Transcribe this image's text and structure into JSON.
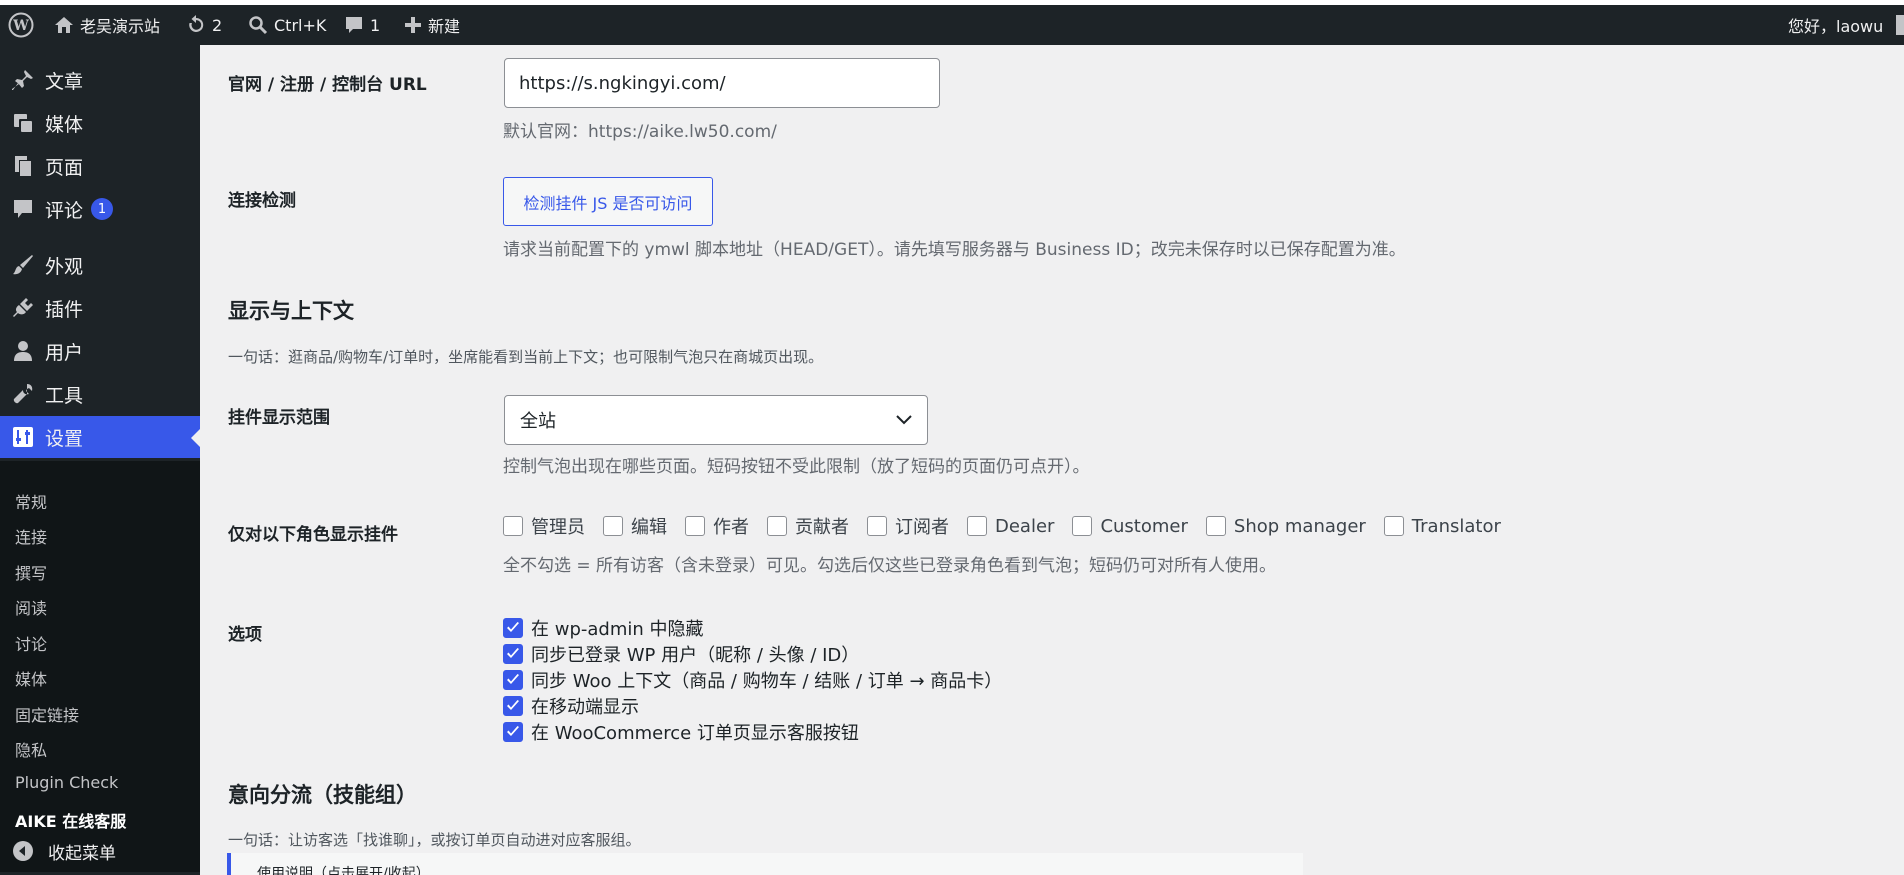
{
  "admin_bar": {
    "site_name": "老吴演示站",
    "updates_count": "2",
    "search_shortcut": "Ctrl+K",
    "comments_count": "1",
    "new_label": "新建",
    "greeting": "您好，laowu"
  },
  "sidebar": {
    "items": [
      {
        "label": "文章",
        "icon": "pin-icon"
      },
      {
        "label": "媒体",
        "icon": "media-icon"
      },
      {
        "label": "页面",
        "icon": "page-icon"
      },
      {
        "label": "评论",
        "icon": "comment-icon",
        "badge": "1"
      },
      {
        "label": "外观",
        "icon": "brush-icon"
      },
      {
        "label": "插件",
        "icon": "plugin-icon"
      },
      {
        "label": "用户",
        "icon": "user-icon"
      },
      {
        "label": "工具",
        "icon": "wrench-icon"
      },
      {
        "label": "设置",
        "icon": "settings-icon",
        "active": true
      }
    ],
    "submenu": [
      "常规",
      "连接",
      "撰写",
      "阅读",
      "讨论",
      "媒体",
      "固定链接",
      "隐私",
      "Plugin Check",
      "AIKE 在线客服"
    ],
    "collapse_label": "收起菜单"
  },
  "main": {
    "url_row": {
      "label": "官网 / 注册 / 控制台 URL",
      "value": "https://s.ngkingyi.com/",
      "desc": "默认官网：https://aike.lw50.com/"
    },
    "connection_row": {
      "label": "连接检测",
      "button": "检测挂件 JS 是否可访问",
      "desc": "请求当前配置下的 ymwl 脚本地址（HEAD/GET）。请先填写服务器与 Business ID；改完未保存时以已保存配置为准。"
    },
    "display_section": {
      "title": "显示与上下文",
      "oneliner": "一句话：逛商品/购物车/订单时，坐席能看到当前上下文；也可限制气泡只在商城页出现。"
    },
    "scope_row": {
      "label": "挂件显示范围",
      "selected": "全站",
      "desc": "控制气泡出现在哪些页面。短码按钮不受此限制（放了短码的页面仍可点开）。"
    },
    "roles_row": {
      "label": "仅对以下角色显示挂件",
      "roles": [
        "管理员",
        "编辑",
        "作者",
        "贡献者",
        "订阅者",
        "Dealer",
        "Customer",
        "Shop manager",
        "Translator"
      ],
      "desc": "全不勾选 = 所有访客（含未登录）可见。勾选后仅这些已登录角色看到气泡；短码仍可对所有人使用。"
    },
    "options_row": {
      "label": "选项",
      "options": [
        "在 wp-admin 中隐藏",
        "同步已登录 WP 用户（昵称 / 头像 / ID）",
        "同步 Woo 上下文（商品 / 购物车 / 结账 / 订单 → 商品卡）",
        "在移动端显示",
        "在 WooCommerce 订单页显示客服按钮"
      ]
    },
    "routing_section": {
      "title": "意向分流（技能组）",
      "oneliner": "一句话：让访客选「找谁聊」，或按订单页自动进对应客服组。",
      "notice": "使用说明（点击展开/收起）"
    }
  }
}
